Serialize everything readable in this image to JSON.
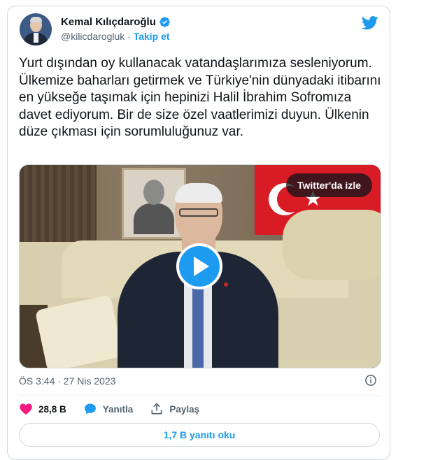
{
  "author": {
    "name": "Kemal Kılıçdaroğlu",
    "handle": "@kilicdarogluk",
    "separator": "·",
    "follow_label": "Takip et"
  },
  "tweet": {
    "text": "Yurt dışından oy kullanacak vatandaşlarımıza sesleniyorum. Ülkemize baharları getirmek ve Türkiye'nin dünyadaki itibarını en yükseğe taşımak için hepinizi Halil İbrahim Sofromıza davet ediyorum. Bir de size özel vaatlerimizi duyun. Ülkenin düze çıkması için sorumluluğunuz var.",
    "timestamp": "ÖS 3:44 · 27 Nis 2023"
  },
  "media": {
    "watch_label": "Twitter'da izle"
  },
  "actions": {
    "likes": "28,8 B",
    "reply_label": "Yanıtla",
    "share_label": "Paylaş"
  },
  "replies_button": "1,7 B yanıtı oku",
  "colors": {
    "accent": "#1d9bf0",
    "like": "#f91880",
    "text": "#0f1419",
    "muted": "#536471"
  },
  "icons": [
    "verified-badge-icon",
    "twitter-bird-icon",
    "play-icon",
    "info-icon",
    "heart-icon",
    "reply-bubble-icon",
    "share-icon"
  ]
}
